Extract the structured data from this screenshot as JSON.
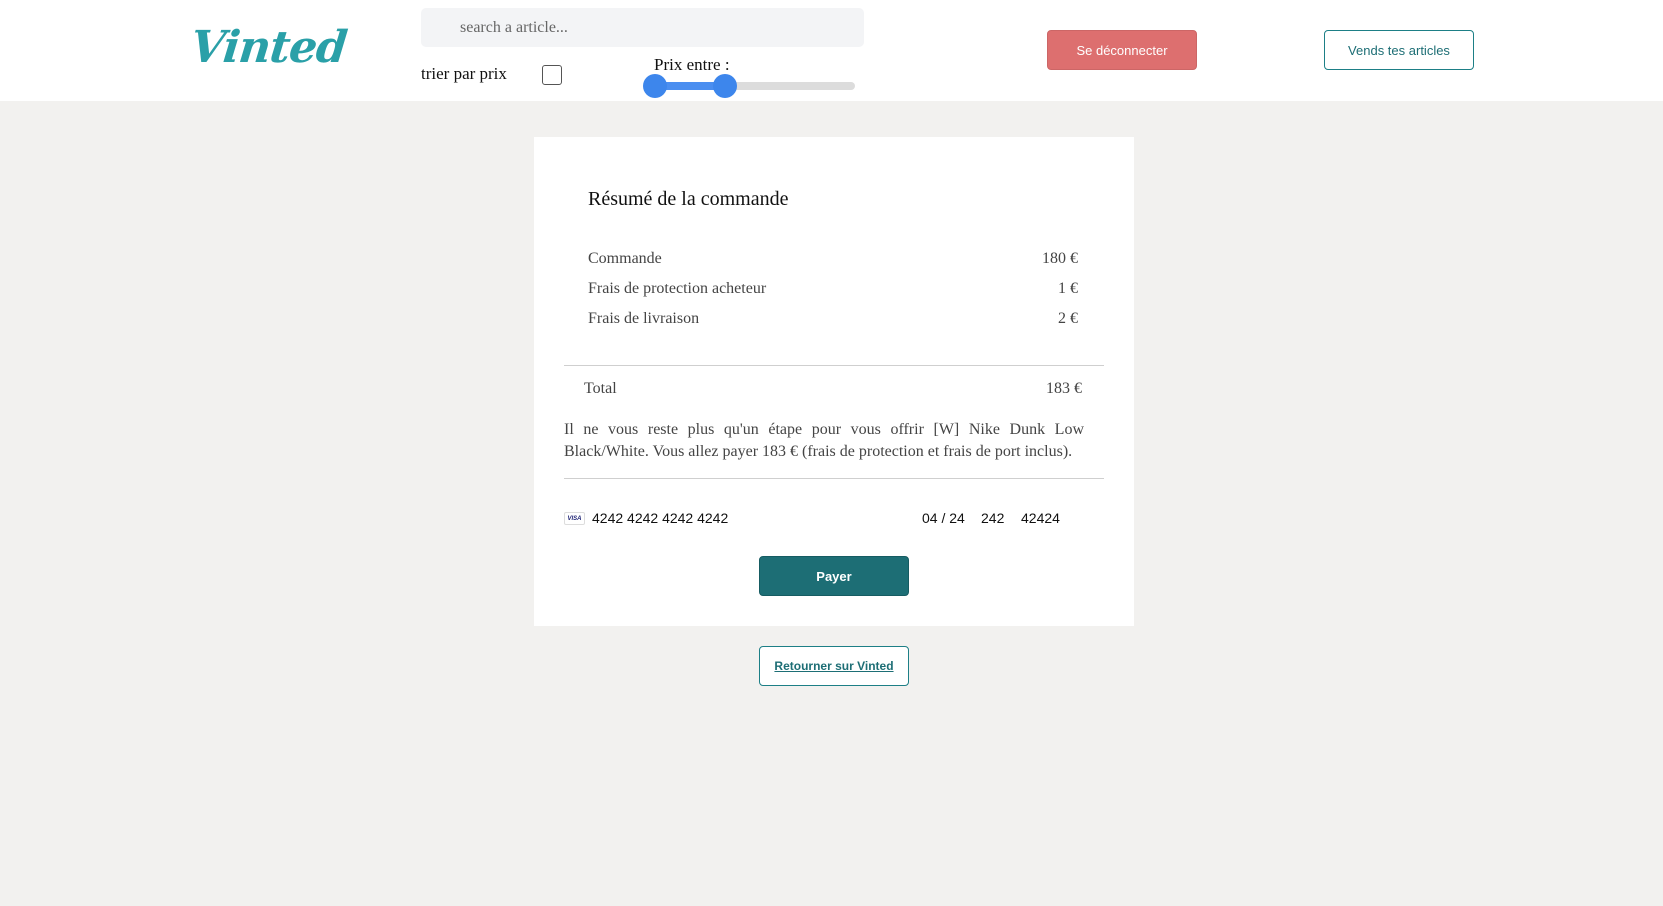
{
  "header": {
    "logo": "Vinted",
    "search": {
      "placeholder": "search a article...",
      "value": ""
    },
    "sort_label": "trier par prix",
    "sort_checked": false,
    "price_label": "Prix entre :",
    "price_range": {
      "min_fraction": 0.0,
      "max_fraction": 0.35
    },
    "logout_label": "Se déconnecter",
    "sell_label": "Vends tes articles"
  },
  "summary": {
    "title": "Résumé de la commande",
    "lines": [
      {
        "label": "Commande",
        "amount": "180 €"
      },
      {
        "label": "Frais de protection acheteur",
        "amount": "1 €"
      },
      {
        "label": "Frais de livraison",
        "amount": "2 €"
      }
    ],
    "total_label": "Total",
    "total_amount": "183 €",
    "message": "Il ne vous reste plus qu'un étape pour vous offrir [W] Nike Dunk Low Black/White. Vous allez payer 183 € (frais de protection et frais de port inclus).",
    "card": {
      "brand": "VISA",
      "number": "4242 4242 4242 4242",
      "expiry": "04 / 24",
      "cvc": "242",
      "zip": "42424"
    },
    "pay_label": "Payer"
  },
  "return_label": "Retourner sur Vinted",
  "colors": {
    "brand": "#2aa0a8",
    "logout": "#dd6f6f",
    "primary": "#1d6e75",
    "slider": "#3d86ec"
  }
}
